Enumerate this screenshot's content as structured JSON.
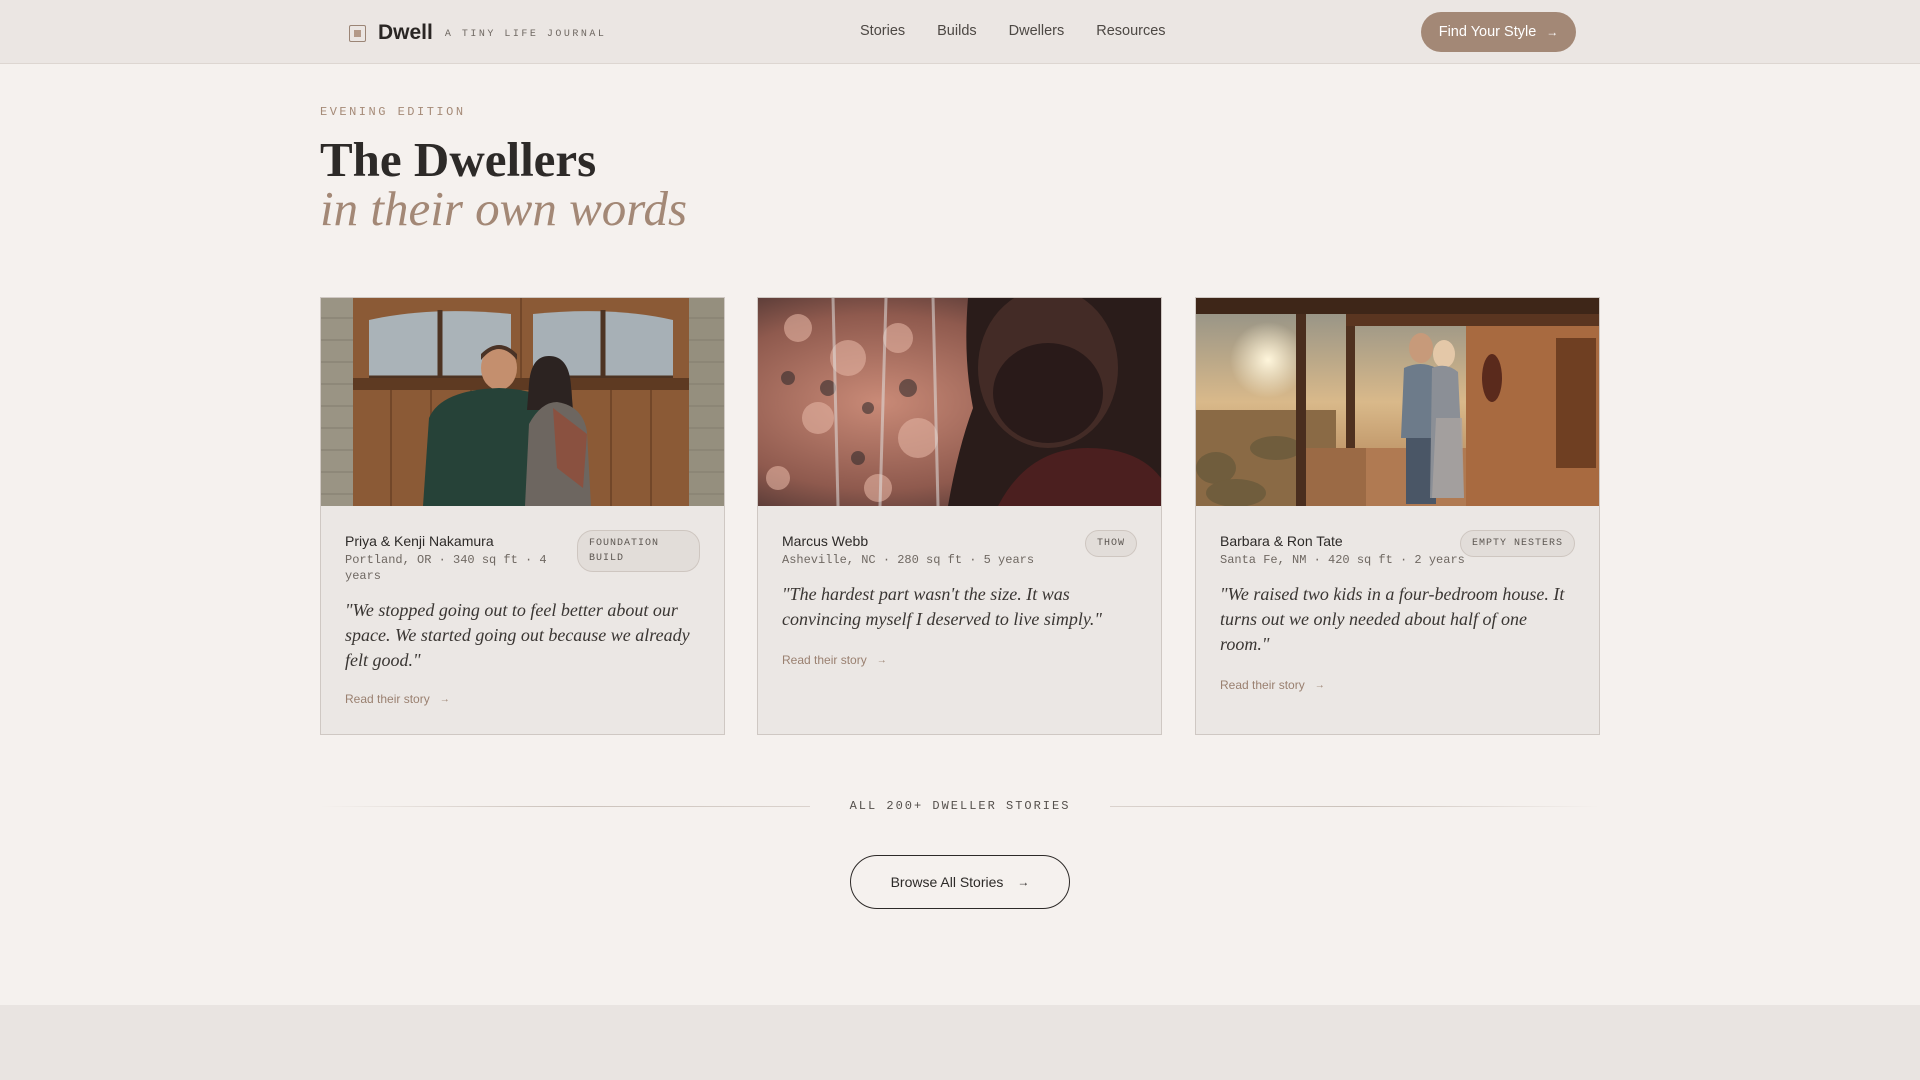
{
  "header": {
    "brand_name": "Dwell",
    "brand_tag": "A TINY LIFE JOURNAL",
    "nav": [
      "Stories",
      "Builds",
      "Dwellers",
      "Resources"
    ],
    "cta_label": "Find Your Style",
    "cta_arrow": "→"
  },
  "hero": {
    "eyebrow": "EVENING EDITION",
    "title": "The Dwellers",
    "subtitle": "in their own words"
  },
  "cards": [
    {
      "name": "Priya & Kenji Nakamura",
      "meta": "Portland, OR · 340 sq ft · 4 years",
      "badge": "FOUNDATION BUILD",
      "quote": "\"We stopped going out to feel better about our space. We started going out because we already felt good.\"",
      "link": "Read their story",
      "arrow": "→"
    },
    {
      "name": "Marcus Webb",
      "meta": "Asheville, NC · 280 sq ft · 5 years",
      "badge": "THOW",
      "quote": "\"The hardest part wasn't the size. It was convincing myself I deserved to live simply.\"",
      "link": "Read their story",
      "arrow": "→"
    },
    {
      "name": "Barbara & Ron Tate",
      "meta": "Santa Fe, NM · 420 sq ft · 2 years",
      "badge": "EMPTY NESTERS",
      "quote": "\"We raised two kids in a four-bedroom house. It turns out we only needed about half of one room.\"",
      "link": "Read their story",
      "arrow": "→"
    }
  ],
  "footer": {
    "count_label": "ALL 200+ DWELLER STORIES",
    "browse_label": "Browse All Stories",
    "browse_arrow": "→"
  },
  "colors": {
    "accent": "#a38876",
    "background": "#f5f1ee",
    "header_bg": "#ebe6e3",
    "card_bg": "#ebe7e4"
  }
}
